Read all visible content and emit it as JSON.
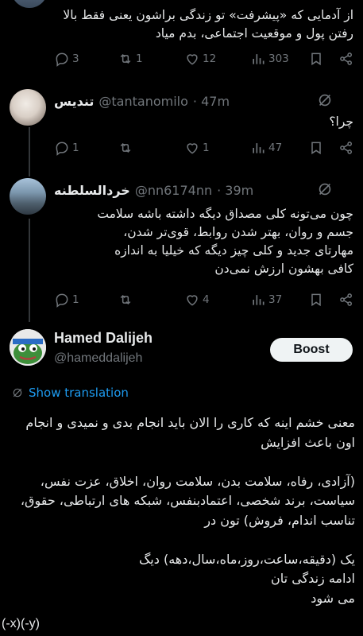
{
  "tweets": [
    {
      "text": "از آدمایی که «پیشرفت» تو زندگی براشون یعنی فقط بالا رفتن پول و موقعیت اجتماعی، بدم میاد",
      "replies": "3",
      "reposts": "1",
      "likes": "12",
      "views": "303"
    },
    {
      "display_name": "تندیس",
      "handle": "@tantanomilo",
      "time": "· 47m",
      "text": "چرا؟",
      "replies": "1",
      "reposts": "",
      "likes": "1",
      "views": "47"
    },
    {
      "display_name": "خردالسلطنه",
      "handle": "@nn6174nn",
      "time": "· 39m",
      "text": "چون می‌تونه کلی مصداق دیگه داشته باشه سلامت جسم و روان، بهتر شدن روابط، قوی‌تر شدن، مهارتای جدید و کلی چیز دیگه که خیلیا به اندازه کافی بهشون ارزش نمی‌دن",
      "replies": "1",
      "reposts": "",
      "likes": "4",
      "views": "37"
    }
  ],
  "main_post": {
    "display_name": "Hamed Dalijeh",
    "handle": "@hameddalijeh",
    "boost_label": "Boost",
    "translate_label": "Show translation",
    "text": "معنی خشم اینه که کاری را الان باید انجام بدی و نمیدی و انجام اون باعث افزایش\n\n(آزادی، رفاه، سلامت بدن، سلامت روان، اخلاق، عزت نفس، سیاست، برند شخصی، اعتمادبنفس، شبکه های ارتباطی، حقوق، تناسب اندام، فروش) تون در\n\nیک (دقیقه،ساعت،روز،ماه،سال،دهه) دیگ\nادامه زندگی تان\nمی شود",
    "formula": "(-x)(-y)"
  },
  "colors": {
    "accent": "#1d9bf0",
    "muted": "#71767b",
    "text": "#e7e9ea",
    "background": "#000000"
  }
}
